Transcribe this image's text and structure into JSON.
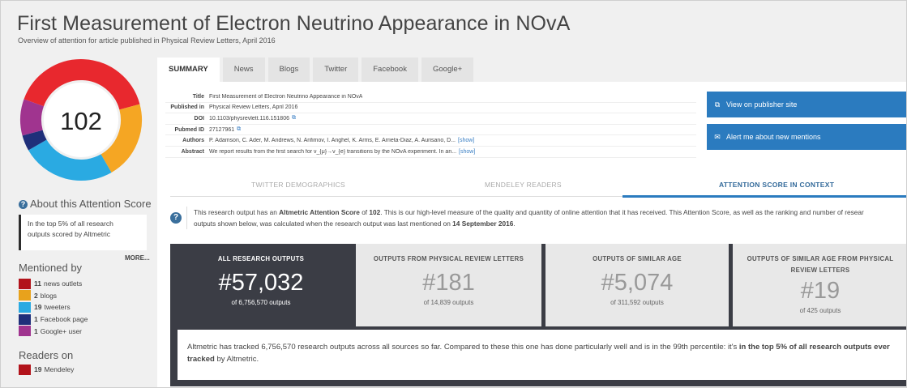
{
  "header": {
    "title": "First Measurement of Electron Neutrino Appearance in NOvA",
    "subtitle": "Overview of attention for article published in Physical Review Letters, April 2016"
  },
  "score": {
    "value": "102",
    "ring_colors": [
      "#e8282e",
      "#f5a623",
      "#2aaae2",
      "#1f2f7a",
      "#a0348f"
    ]
  },
  "about": {
    "heading": "About this Attention Score",
    "top_text_1": "In the top 5% of all research",
    "top_text_2": "outputs scored by Altmetric",
    "more": "MORE..."
  },
  "mentioned_by": {
    "heading": "Mentioned by",
    "items": [
      {
        "count": "11",
        "label": "news outlets",
        "color": "#b2131b"
      },
      {
        "count": "2",
        "label": "blogs",
        "color": "#e8a21c"
      },
      {
        "count": "19",
        "label": "tweeters",
        "color": "#2aaae2"
      },
      {
        "count": "1",
        "label": "Facebook page",
        "color": "#1f2f7a"
      },
      {
        "count": "1",
        "label": "Google+ user",
        "color": "#a0348f"
      }
    ]
  },
  "readers_on": {
    "heading": "Readers on",
    "items": [
      {
        "count": "19",
        "label": "Mendeley",
        "color": "#b2131b"
      }
    ]
  },
  "tabs": [
    "SUMMARY",
    "News",
    "Blogs",
    "Twitter",
    "Facebook",
    "Google+"
  ],
  "meta": {
    "title_key": "Title",
    "title_val": "First Measurement of Electron Neutrino Appearance in NOvA",
    "published_key": "Published in",
    "published_val": "Physical Review Letters, April 2016",
    "doi_key": "DOI",
    "doi_val": "10.1103/physrevlett.116.151806",
    "pubmed_key": "Pubmed ID",
    "pubmed_val": "27127961",
    "authors_key": "Authors",
    "authors_val": "P. Adamson, C. Ader, M. Andrews, N. Anfimov, I. Anghel, K. Arms, E. Arrieta-Diaz, A. Aurisano, D...",
    "authors_link": "[show]",
    "abstract_key": "Abstract",
    "abstract_val": "We report results from the first search for ν_{μ}→ν_{e} transitions by the NOvA experiment. In an...",
    "abstract_link": "[show]"
  },
  "actions": {
    "publisher": "View on publisher site",
    "alert": "Alert me about new mentions"
  },
  "context_tabs": [
    "TWITTER DEMOGRAPHICS",
    "MENDELEY READERS",
    "ATTENTION SCORE IN CONTEXT"
  ],
  "explain": {
    "line1_a": "This research output has an ",
    "line1_b": "Altmetric Attention Score",
    "line1_c": " of ",
    "line1_d": "102",
    "line1_e": ". This is our high-level measure of the quality and quantity of online attention that it has received. This Attention Score, as well as the ranking and number of resear",
    "line2_a": "outputs shown below, was calculated when the research output was last mentioned on ",
    "line2_b": "14 September 2016",
    "line2_c": "."
  },
  "stats": [
    {
      "label": "ALL RESEARCH OUTPUTS",
      "number": "#57,032",
      "of": "of 6,756,570 outputs"
    },
    {
      "label": "OUTPUTS FROM PHYSICAL REVIEW LETTERS",
      "number": "#181",
      "of": "of 14,839 outputs"
    },
    {
      "label": "OUTPUTS OF SIMILAR AGE",
      "number": "#5,074",
      "of": "of 311,592 outputs"
    },
    {
      "label": "OUTPUTS OF SIMILAR AGE FROM PHYSICAL REVIEW LETTERS",
      "number": "#19",
      "of": "of 425 outputs"
    }
  ],
  "summary": {
    "text_a": "Altmetric has tracked 6,756,570 research outputs across all sources so far. Compared to these this one has done particularly well and is in the 99th percentile: it's ",
    "text_b": "in the top 5% of all research outputs ever tracked",
    "text_c": " by Altmetric."
  }
}
